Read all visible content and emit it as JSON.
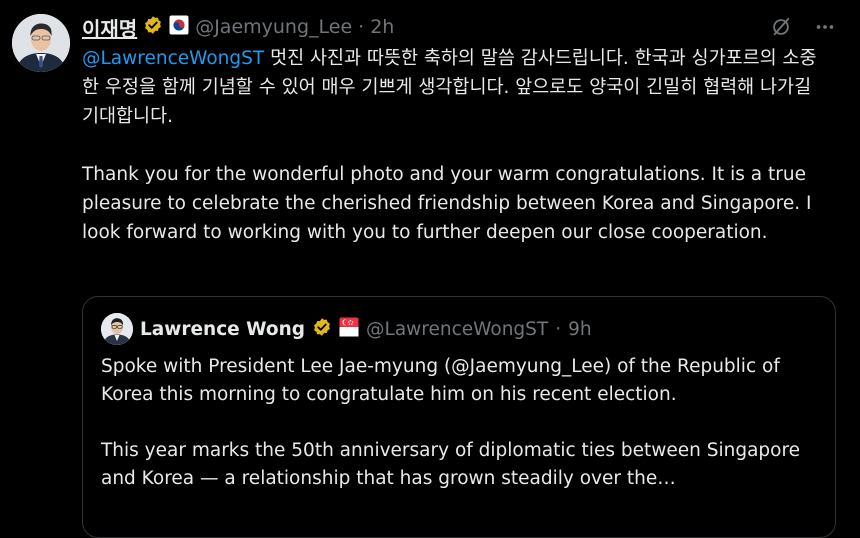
{
  "author": {
    "display_name": "이재명",
    "handle": "@Jaemyung_Lee",
    "separator": "·",
    "time": "2h"
  },
  "icons": {
    "grok": "grok-icon",
    "more": "more-icon",
    "verified": "verified-badge-icon"
  },
  "tweet": {
    "korean_mention": "@LawrenceWongST",
    "korean_text": " 멋진 사진과 따뜻한 축하의 말씀 감사드립니다. 한국과 싱가포르의 소중한 우정을 함께 기념할 수 있어 매우 기쁘게 생각합니다. 앞으로도 양국이 긴밀히 협력해 나가길 기대합니다.",
    "english_text": "Thank you for the wonderful photo and your warm congratulations. It is a true pleasure to celebrate the cherished friendship between Korea and Singapore. I look forward to working with you to further deepen our close cooperation."
  },
  "quoted": {
    "display_name": "Lawrence Wong",
    "handle": "@LawrenceWongST",
    "separator": "·",
    "time": "9h",
    "paragraph1": "Spoke with President Lee Jae-myung (@Jaemyung_Lee) of the Republic of Korea this morning to congratulate him on his recent election.",
    "paragraph2": "This year marks the 50th anniversary of diplomatic ties between Singapore and Korea — a relationship that has grown steadily over the…"
  },
  "colors": {
    "background": "#000000",
    "text": "#e7e9ea",
    "secondary": "#71767b",
    "link": "#1d9bf0",
    "border": "#2f3336",
    "gold_badge": "#e2b719"
  }
}
